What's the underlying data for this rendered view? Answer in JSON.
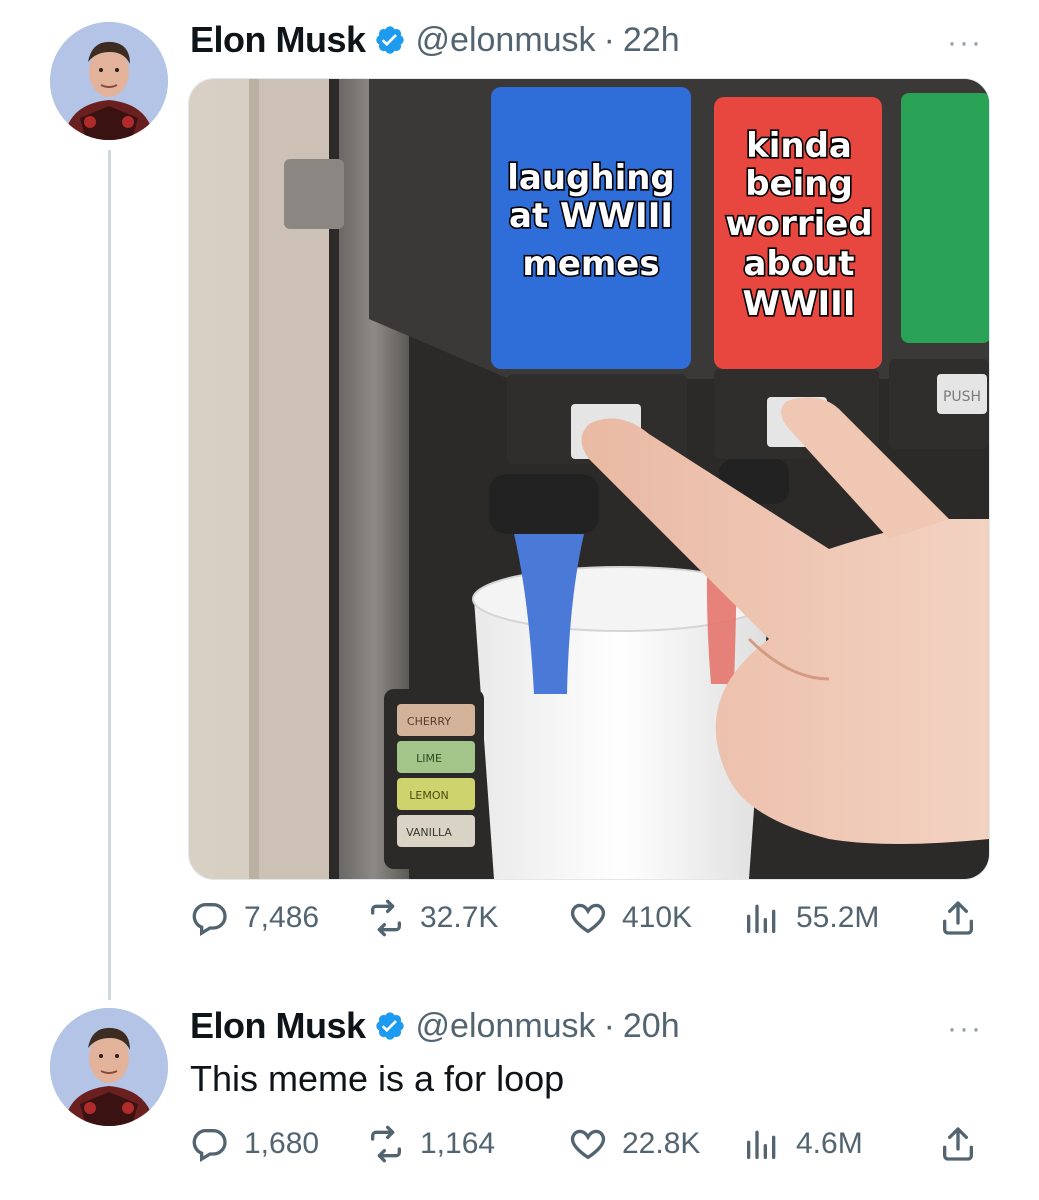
{
  "tweets": [
    {
      "author": {
        "name": "Elon Musk",
        "handle": "@elonmusk",
        "verified": true
      },
      "time": "22h",
      "more": "···",
      "media": {
        "labels": {
          "blue": [
            "laughing",
            "at WWIII",
            "memes"
          ],
          "red": [
            "kinda",
            "being",
            "worried",
            "about",
            "WWIII"
          ],
          "push": "PUSH",
          "flavors": [
            "CHERRY",
            "LIME",
            "LEMON",
            "VANILLA"
          ]
        }
      },
      "stats": {
        "replies": "7,486",
        "retweets": "32.7K",
        "likes": "410K",
        "views": "55.2M"
      }
    },
    {
      "author": {
        "name": "Elon Musk",
        "handle": "@elonmusk",
        "verified": true
      },
      "time": "20h",
      "more": "···",
      "text": "This meme is a for loop",
      "stats": {
        "replies": "1,680",
        "retweets": "1,164",
        "likes": "22.8K",
        "views": "4.6M"
      }
    }
  ],
  "colors": {
    "verified": "#1d9bf0",
    "icon": "#536471",
    "blue_label": "#2f6ed8",
    "red_label": "#e8473f",
    "green_label": "#2aa356"
  },
  "icons": [
    "reply-icon",
    "retweet-icon",
    "like-icon",
    "views-icon",
    "share-icon",
    "verified-icon",
    "more-icon"
  ]
}
